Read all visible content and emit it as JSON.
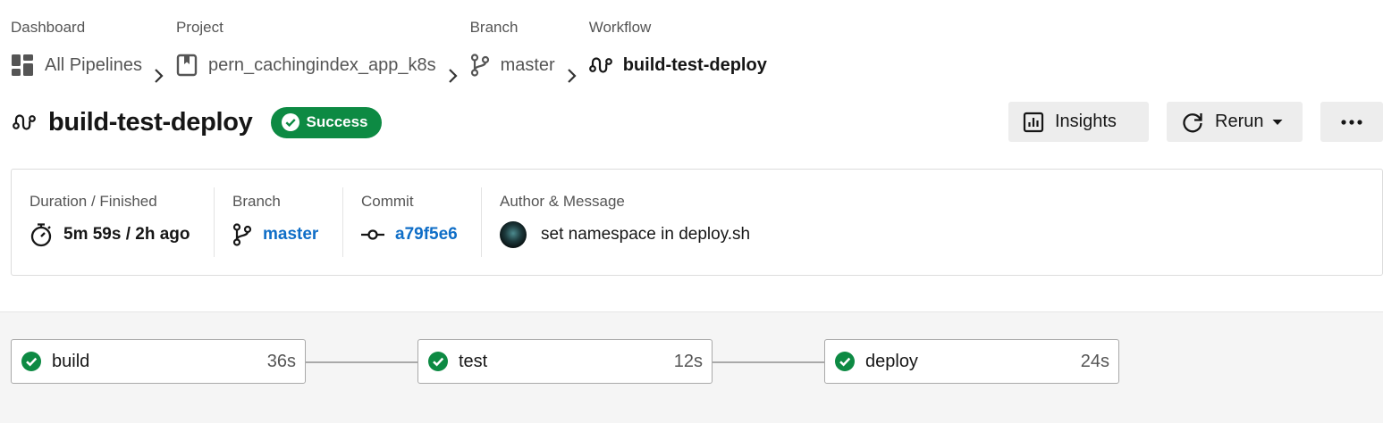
{
  "breadcrumb": {
    "dashboard": {
      "label": "Dashboard",
      "value": "All Pipelines"
    },
    "project": {
      "label": "Project",
      "value": "pern_cachingindex_app_k8s"
    },
    "branch": {
      "label": "Branch",
      "value": "master"
    },
    "workflow": {
      "label": "Workflow",
      "value": "build-test-deploy"
    }
  },
  "header": {
    "title": "build-test-deploy",
    "status": "Success",
    "insights_label": "Insights",
    "rerun_label": "Rerun",
    "more_label": "..."
  },
  "summary": {
    "duration": {
      "label": "Duration / Finished",
      "value": "5m 59s / 2h ago"
    },
    "branch": {
      "label": "Branch",
      "value": "master"
    },
    "commit": {
      "label": "Commit",
      "value": "a79f5e6"
    },
    "author": {
      "label": "Author & Message",
      "message": "set namespace in deploy.sh"
    }
  },
  "jobs": [
    {
      "name": "build",
      "duration": "36s",
      "status": "success"
    },
    {
      "name": "test",
      "duration": "12s",
      "status": "success"
    },
    {
      "name": "deploy",
      "duration": "24s",
      "status": "success"
    }
  ],
  "colors": {
    "success": "#0d8a43",
    "link": "#0f6ec7",
    "graph_bg": "#f5f5f5",
    "button_bg": "#ededed"
  },
  "icons": [
    "dashboard-icon",
    "chevron-right-icon",
    "project-icon",
    "branch-icon",
    "workflow-icon",
    "check-circle-icon",
    "insights-icon",
    "rerun-icon",
    "caret-down-icon",
    "more-icon",
    "timer-icon",
    "commit-icon"
  ]
}
